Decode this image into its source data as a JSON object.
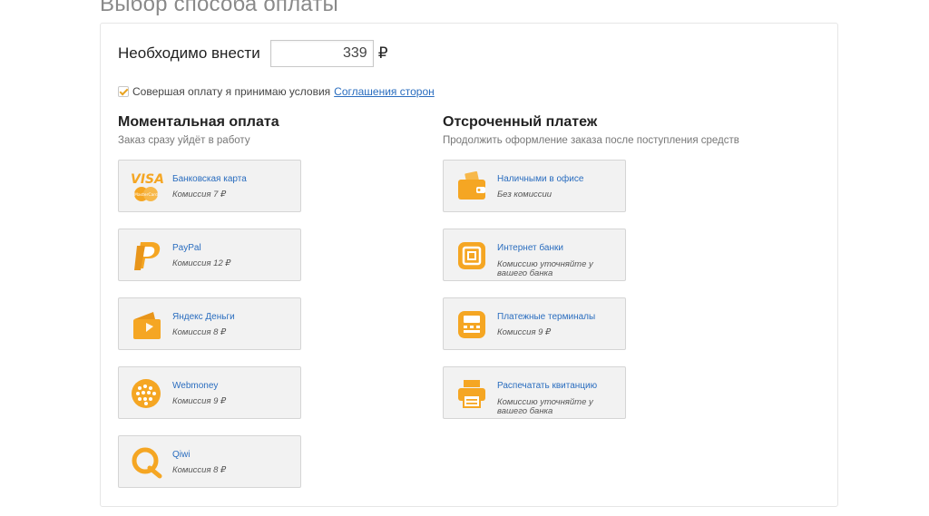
{
  "page": {
    "title": "Выбор способа оплаты"
  },
  "payment": {
    "amount_label": "Необходимо внести",
    "amount_value": "339",
    "currency": "₽",
    "agreement_text": "Совершая оплату я принимаю условия",
    "agreement_link": "Соглашения сторон",
    "agreement_checked": true
  },
  "instant": {
    "title": "Моментальная оплата",
    "subtitle": "Заказ сразу уйдёт в работу",
    "options": [
      {
        "name": "Банковская карта",
        "fee": "Комиссия 7 ₽",
        "icon": "visa-mastercard-icon"
      },
      {
        "name": "PayPal",
        "fee": "Комиссия 12 ₽",
        "icon": "paypal-icon"
      },
      {
        "name": "Яндекс Деньги",
        "fee": "Комиссия 8 ₽",
        "icon": "yandex-money-wallet-icon"
      },
      {
        "name": "Webmoney",
        "fee": "Комиссия 9 ₽",
        "icon": "webmoney-globe-icon"
      },
      {
        "name": "Qiwi",
        "fee": "Комиссия 8 ₽",
        "icon": "qiwi-icon"
      }
    ]
  },
  "deferred": {
    "title": "Отсроченный платеж",
    "subtitle": "Продолжить оформление заказа после поступления средств",
    "options": [
      {
        "name": "Наличными в офисе",
        "fee": "Без комиссии",
        "icon": "cash-wallet-icon"
      },
      {
        "name": "Интернет банки",
        "fee": "Комиссию уточняйте у вашего банка",
        "icon": "internet-bank-icon"
      },
      {
        "name": "Платежные терминалы",
        "fee": "Комиссия 9 ₽",
        "icon": "payment-terminal-icon"
      },
      {
        "name": "Распечатать квитанцию",
        "fee": "Комиссию уточняйте у вашего банка",
        "icon": "printer-icon"
      }
    ]
  },
  "colors": {
    "accent": "#f5a623",
    "link": "#2a6dbf",
    "card_bg": "#f2f2f2",
    "card_border": "#d5d5d5"
  }
}
